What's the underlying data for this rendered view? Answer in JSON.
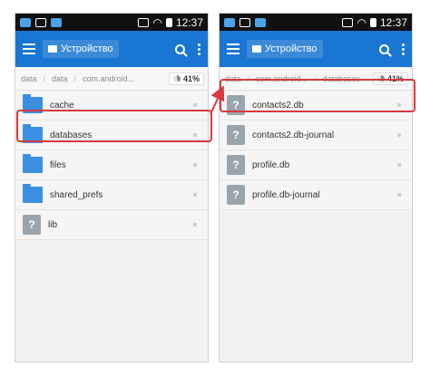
{
  "status": {
    "time": "12:37"
  },
  "left": {
    "location": "Устройство",
    "breadcrumbs": [
      "data",
      "data",
      "com.android..."
    ],
    "storage": "41%",
    "items": [
      {
        "name": "cache",
        "type": "folder"
      },
      {
        "name": "databases",
        "type": "folder"
      },
      {
        "name": "files",
        "type": "folder"
      },
      {
        "name": "shared_prefs",
        "type": "folder"
      },
      {
        "name": "lib",
        "type": "file"
      }
    ]
  },
  "right": {
    "location": "Устройство",
    "breadcrumbs": [
      "data",
      "com.android...",
      "databases"
    ],
    "storage": "41%",
    "items": [
      {
        "name": "contacts2.db",
        "type": "file"
      },
      {
        "name": "contacts2.db-journal",
        "type": "file"
      },
      {
        "name": "profile.db",
        "type": "file"
      },
      {
        "name": "profile.db-journal",
        "type": "file"
      }
    ]
  },
  "colors": {
    "accent": "#1976d2",
    "highlight": "#d8393d",
    "folder": "#3b8fe0"
  },
  "icons": {
    "file_glyph": "?"
  }
}
